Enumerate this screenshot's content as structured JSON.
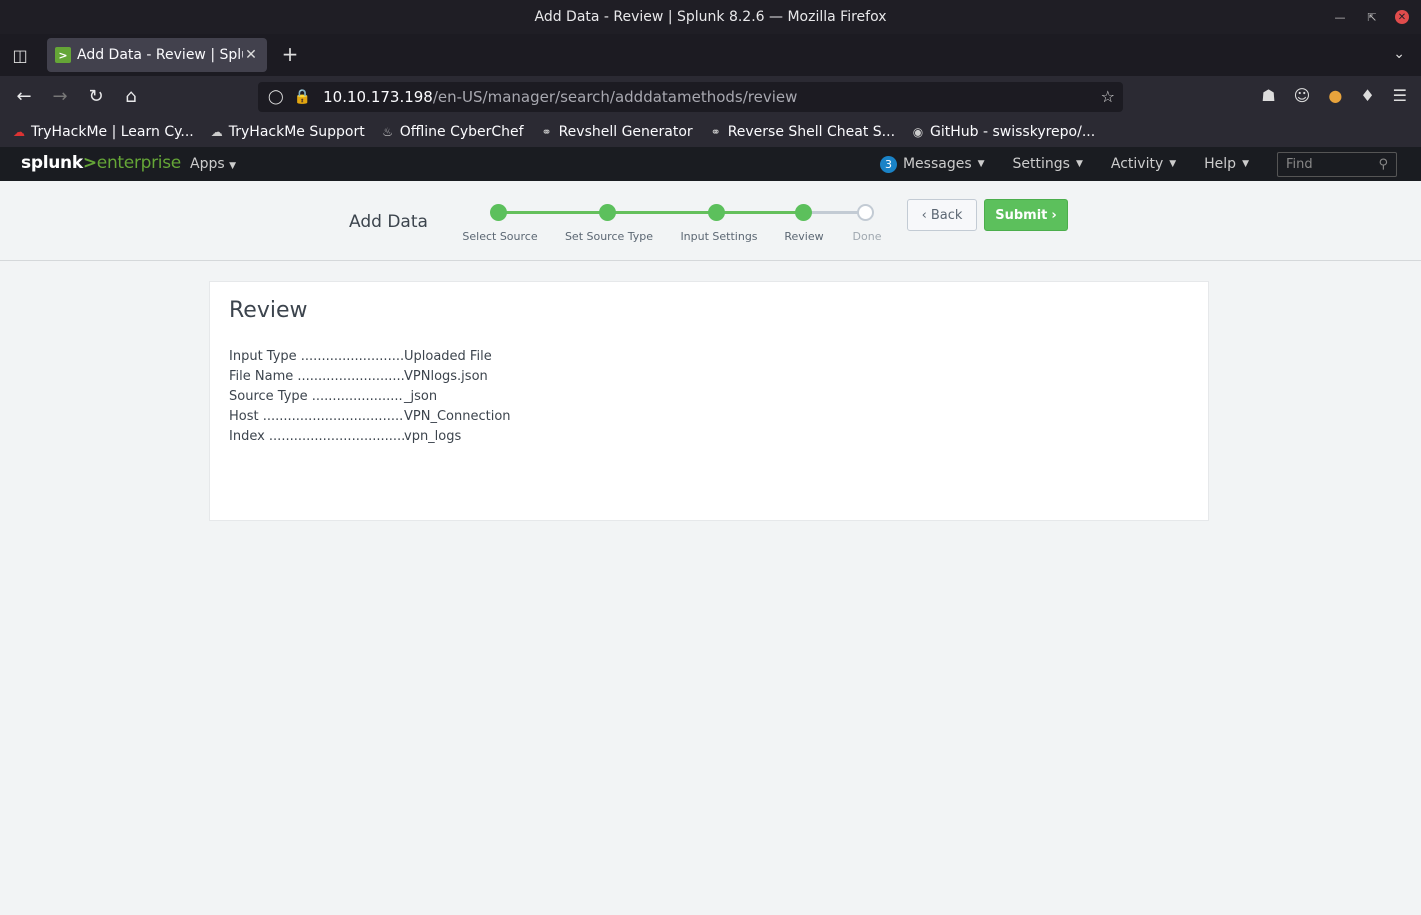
{
  "window": {
    "title": "Add Data - Review | Splunk 8.2.6 — Mozilla Firefox"
  },
  "tab": {
    "title": "Add Data - Review | Splunk 8.2.6"
  },
  "url": {
    "host": "10.10.173.198",
    "path": "/en-US/manager/search/adddatamethods/review"
  },
  "bookmarks": [
    {
      "label": "TryHackMe | Learn Cy..."
    },
    {
      "label": "TryHackMe Support"
    },
    {
      "label": "Offline CyberChef"
    },
    {
      "label": "Revshell Generator"
    },
    {
      "label": "Reverse Shell Cheat S..."
    },
    {
      "label": "GitHub - swisskyrepo/..."
    }
  ],
  "splunk": {
    "logo_main": "splunk",
    "logo_gt": ">",
    "logo_sub": "enterprise",
    "apps": "Apps",
    "messages_count": "3",
    "messages": "Messages",
    "settings": "Settings",
    "activity": "Activity",
    "help": "Help",
    "find_placeholder": "Find"
  },
  "wizard": {
    "title": "Add Data",
    "steps": [
      {
        "label": "Select Source"
      },
      {
        "label": "Set Source Type"
      },
      {
        "label": "Input Settings"
      },
      {
        "label": "Review"
      },
      {
        "label": "Done"
      }
    ],
    "back": "Back",
    "submit": "Submit"
  },
  "review": {
    "title": "Review",
    "rows": [
      {
        "key": "Input Type ................................",
        "value": "Uploaded File"
      },
      {
        "key": "File Name ................................",
        "value": "VPNlogs.json"
      },
      {
        "key": "Source Type ............................",
        "value": "_json"
      },
      {
        "key": "Host ..........................................",
        "value": "VPN_Connection"
      },
      {
        "key": "Index ........................................",
        "value": "vpn_logs"
      }
    ]
  }
}
